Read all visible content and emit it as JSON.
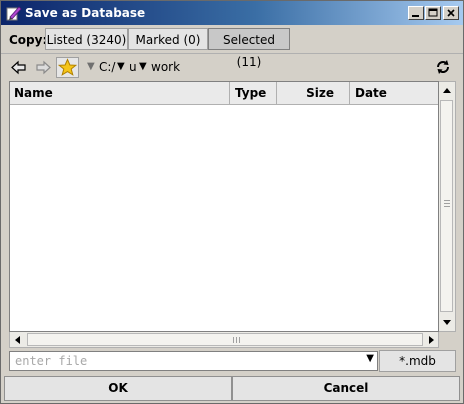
{
  "window": {
    "title": "Save as Database",
    "controls": [
      "minimize-icon",
      "maximize-icon",
      "close-icon"
    ]
  },
  "copy": {
    "label": "Copy:",
    "options": [
      "Listed (3240)",
      "Marked (0)",
      "Selected (11)"
    ],
    "selected": "Selected (11)"
  },
  "nav": {
    "back_icon": "back-arrow-icon",
    "forward_icon": "forward-arrow-icon",
    "favorite_icon": "star-icon",
    "path": [
      "C:/",
      "u",
      "work"
    ],
    "refresh_icon": "refresh-icon"
  },
  "table": {
    "columns": [
      "Name",
      "Type",
      "Size",
      "Date"
    ],
    "rows": []
  },
  "file": {
    "placeholder": "enter file",
    "value": "",
    "filter": "*.mdb"
  },
  "buttons": {
    "ok": "OK",
    "cancel": "Cancel"
  },
  "colors": {
    "title_gradient_start": "#0b246a",
    "title_gradient_end": "#a6caf0",
    "favorite_star": "#f5c518"
  }
}
